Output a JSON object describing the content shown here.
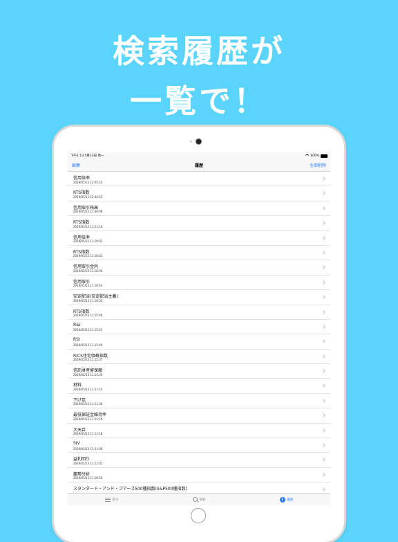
{
  "headline": {
    "line1": "検索履歴が",
    "line2": "一覧で！"
  },
  "status": {
    "time": "下午1:13  5月13日 周一",
    "battery": "100%"
  },
  "nav": {
    "edit": "編集",
    "title": "履歴",
    "delete_all": "全部削除"
  },
  "history": [
    {
      "term": "信用倍率",
      "date": "2019/05/13 12:05:10"
    },
    {
      "term": "RTS指数",
      "date": "2019/05/13 12:04:52"
    },
    {
      "term": "信用取引残高",
      "date": "2019/05/13 11:49:08"
    },
    {
      "term": "RTS指数",
      "date": "2019/05/13 11:21:16"
    },
    {
      "term": "信用倍率",
      "date": "2019/05/13 11:19:03"
    },
    {
      "term": "RTS指数",
      "date": "2019/05/13 11:18:45"
    },
    {
      "term": "信用取引金利",
      "date": "2019/05/13 11:16:59"
    },
    {
      "term": "信用取引",
      "date": "2019/05/13 11:16:54"
    },
    {
      "term": "安定配当(安定配当主義)",
      "date": "2019/05/13 11:16:32"
    },
    {
      "term": "RTS指数",
      "date": "2019/05/13 11:15:46"
    },
    {
      "term": "R&I",
      "date": "2019/05/13 11:15:43"
    },
    {
      "term": "RSI",
      "date": "2019/05/13 11:15:40"
    },
    {
      "term": "RICS住宅価格指数",
      "date": "2019/05/13 11:15:37"
    },
    {
      "term": "信託財産留保額",
      "date": "2019/05/13 11:14:29"
    },
    {
      "term": "材料",
      "date": "2019/05/13 11:11:55"
    },
    {
      "term": "下げ足",
      "date": "2019/05/13 11:11:36"
    },
    {
      "term": "最低保証金維持率",
      "date": "2019/05/13 11:11:29"
    },
    {
      "term": "大天井",
      "date": "2019/05/13 11:11:18"
    },
    {
      "term": "SIV",
      "date": "2019/05/13 11:11:06"
    },
    {
      "term": "益利回り",
      "date": "2019/05/13 11:11:02"
    },
    {
      "term": "趨勢分析",
      "date": "2019/05/13 11:10:50"
    },
    {
      "term": "スタンダード・アンド・プアーズ500種指数(S&P500種指数)",
      "date": ""
    }
  ],
  "tabs": {
    "index": "索引",
    "search": "検索",
    "history": "履歴"
  },
  "colors": {
    "background": "#5bd4fb",
    "accent": "#2d7ff9"
  }
}
